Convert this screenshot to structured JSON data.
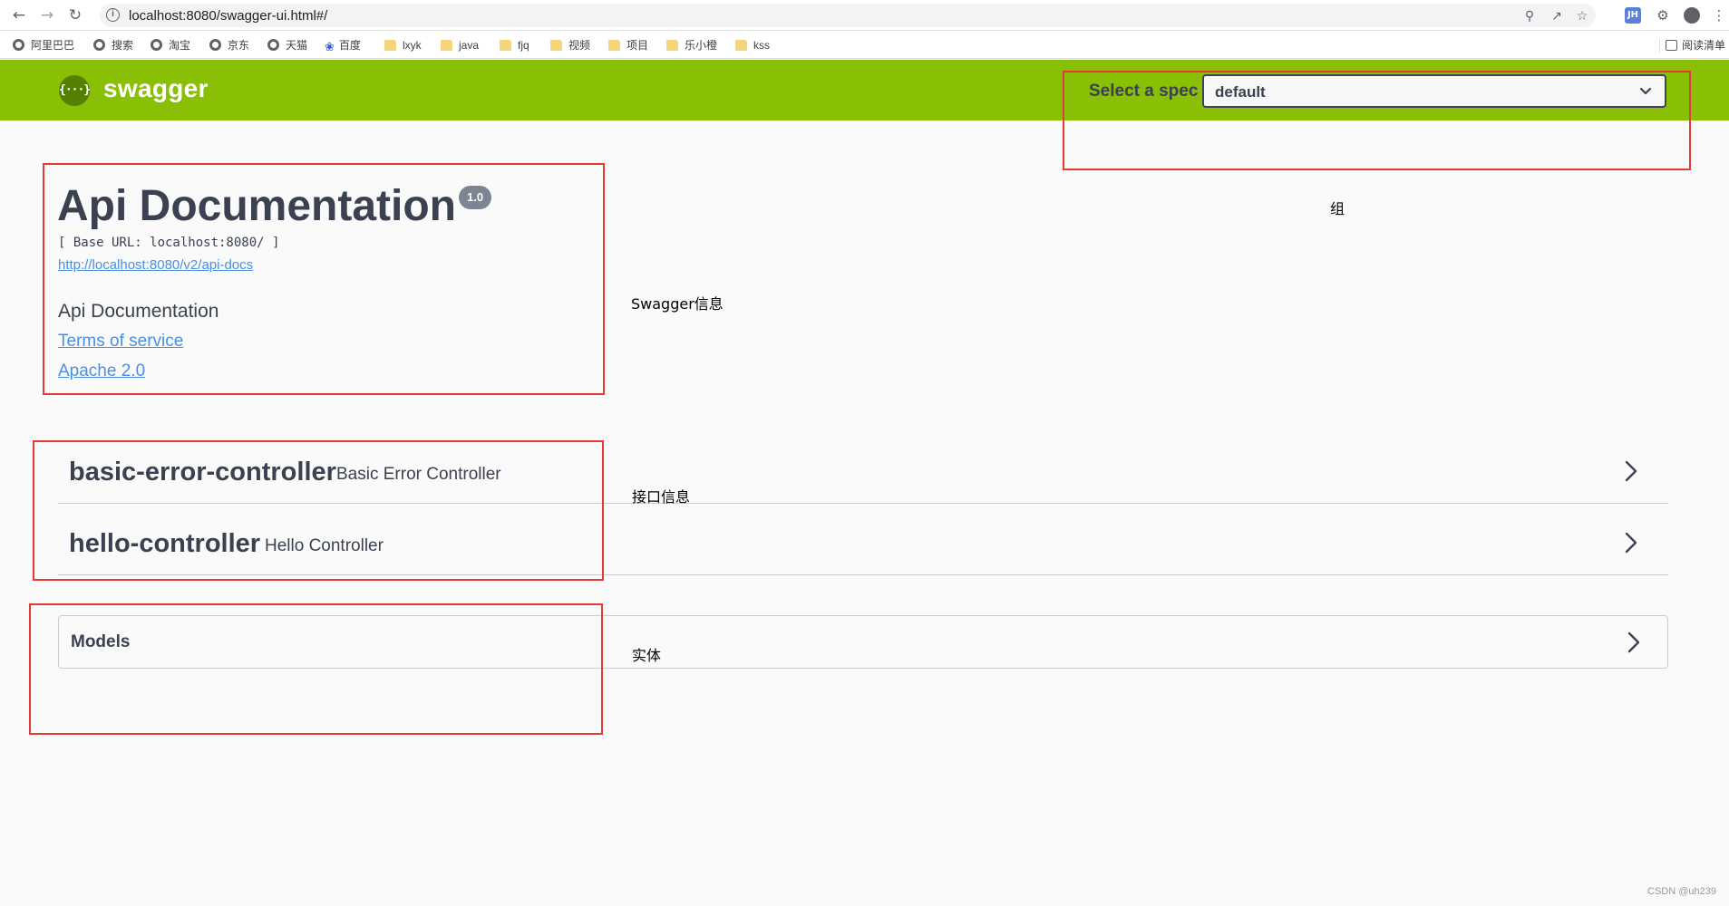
{
  "browser": {
    "url": "localhost:8080/swagger-ui.html#/",
    "bookmarks": [
      {
        "label": "阿里巴巴",
        "icon": "globe-icon"
      },
      {
        "label": "搜索",
        "icon": "globe-icon"
      },
      {
        "label": "淘宝",
        "icon": "globe-icon"
      },
      {
        "label": "京东",
        "icon": "globe-icon"
      },
      {
        "label": "天猫",
        "icon": "globe-icon"
      },
      {
        "label": "百度",
        "icon": "paw-icon"
      },
      {
        "label": "lxyk",
        "icon": "folder-icon"
      },
      {
        "label": "java",
        "icon": "folder-icon"
      },
      {
        "label": "fjq",
        "icon": "folder-icon"
      },
      {
        "label": "视频",
        "icon": "folder-icon"
      },
      {
        "label": "项目",
        "icon": "folder-icon"
      },
      {
        "label": "乐小橙",
        "icon": "folder-icon"
      },
      {
        "label": "kss",
        "icon": "folder-icon"
      }
    ],
    "reading_list": "阅读清单",
    "extension_badge": "JH"
  },
  "topbar": {
    "logo_glyph": "{···}",
    "logo_text": "swagger",
    "spec_label": "Select a spec",
    "spec_value": "default",
    "bg_color": "#89bf04"
  },
  "info": {
    "title": "Api Documentation",
    "version": "1.0",
    "base_url": "[ Base URL: localhost:8080/ ]",
    "api_docs_link": "http://localhost:8080/v2/api-docs",
    "description": "Api Documentation",
    "terms_link": "Terms of service",
    "license_link": "Apache 2.0"
  },
  "tags": [
    {
      "name": "basic-error-controller",
      "description": "Basic Error Controller"
    },
    {
      "name": "hello-controller",
      "description": "Hello Controller"
    }
  ],
  "models": {
    "title": "Models"
  },
  "annotations": {
    "group": "组",
    "swagger_info": "Swagger信息",
    "api_info": "接口信息",
    "entity": "实体",
    "box_color": "#e53935"
  },
  "watermark": "CSDN @uh239"
}
